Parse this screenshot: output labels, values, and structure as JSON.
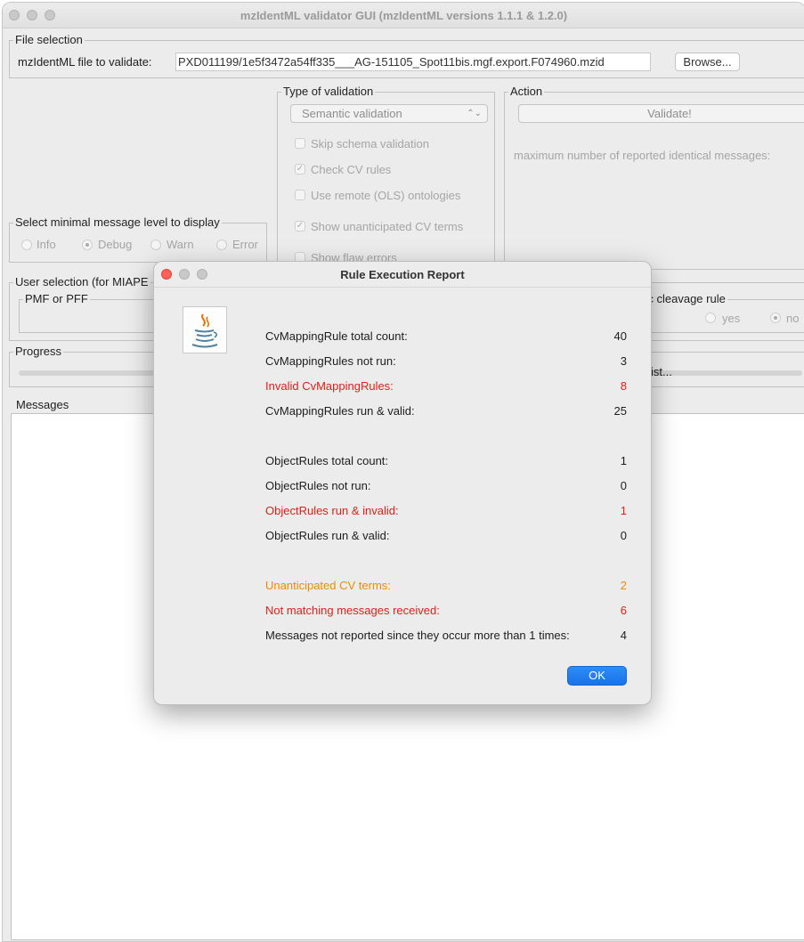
{
  "colors": {
    "invalid": "#e0201b",
    "warning": "#ee8c00",
    "ok_button": "#1a73e8"
  },
  "window": {
    "title": "mzIdentML validator GUI (mzIdentML versions 1.1.1 & 1.2.0)"
  },
  "file_selection": {
    "group_label": "File selection",
    "label": "mzIdentML file to validate:",
    "value": "PXD011199/1e5f3472a54ff335___AG-151105_Spot11bis.mgf.export.F074960.mzid",
    "browse_label": "Browse..."
  },
  "type_of_validation": {
    "group_label": "Type of validation",
    "selected": "Semantic validation",
    "options": [
      {
        "label": "Skip schema validation",
        "checked": false
      },
      {
        "label": "Check CV rules",
        "checked": true
      },
      {
        "label": "Use remote (OLS) ontologies",
        "checked": false
      },
      {
        "label": "Show unanticipated CV terms",
        "checked": true
      },
      {
        "label": "Show flaw errors",
        "checked": false
      }
    ]
  },
  "action": {
    "group_label": "Action",
    "validate_label": "Validate!",
    "max_messages_label": "maximum number of reported identical messages:"
  },
  "message_level": {
    "group_label": "Select minimal message level to display",
    "options": [
      "Info",
      "Debug",
      "Warn",
      "Error"
    ],
    "selected": "Debug"
  },
  "user_selection": {
    "group_label": "User selection (for MIAPE",
    "pmf_label": "PMF or PFF"
  },
  "cleavage": {
    "group_label": "ific cleavage rule",
    "options": [
      "yes",
      "no"
    ],
    "selected": "no"
  },
  "progress": {
    "group_label": "Progress",
    "partial_button": "ist..."
  },
  "messages": {
    "group_label": "Messages"
  },
  "dialog": {
    "title": "Rule Execution Report",
    "icon": "java-coffee-icon",
    "rows": [
      {
        "label": "CvMappingRule total count:",
        "value": "40",
        "style": "normal"
      },
      {
        "label": "CvMappingRules not run:",
        "value": "3",
        "style": "normal"
      },
      {
        "label": "Invalid CvMappingRules:",
        "value": "8",
        "style": "invalid"
      },
      {
        "label": "CvMappingRules run & valid:",
        "value": "25",
        "style": "normal"
      },
      {
        "label": "ObjectRules total count:",
        "value": "1",
        "style": "normal"
      },
      {
        "label": "ObjectRules not run:",
        "value": "0",
        "style": "normal"
      },
      {
        "label": "ObjectRules run & invalid:",
        "value": "1",
        "style": "invalid"
      },
      {
        "label": "ObjectRules run & valid:",
        "value": "0",
        "style": "normal"
      },
      {
        "label": "Unanticipated CV terms:",
        "value": "2",
        "style": "warning"
      },
      {
        "label": "Not matching messages received:",
        "value": "6",
        "style": "invalid"
      },
      {
        "label": "Messages not reported since they occur more than 1 times:",
        "value": "4",
        "style": "normal"
      }
    ],
    "ok_label": "OK"
  }
}
